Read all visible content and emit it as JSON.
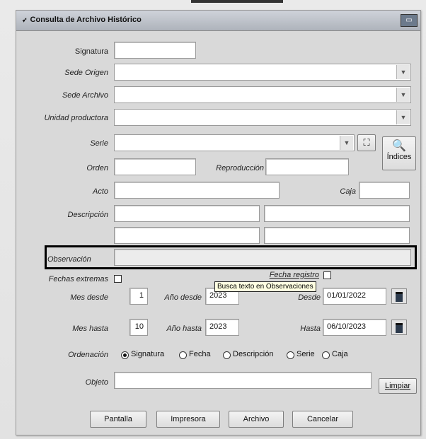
{
  "window": {
    "title": "Consulta de Archivo Histórico",
    "close_glyph": "▭"
  },
  "labels": {
    "signatura": "Signatura",
    "sede_origen": "Sede Origen",
    "sede_archivo": "Sede Archivo",
    "unidad_productora": "Unidad productora",
    "serie": "Serie",
    "orden": "Orden",
    "reproduccion": "Reproducción",
    "acto": "Acto",
    "caja": "Caja",
    "descripcion": "Descripción",
    "observacion": "Observación",
    "fechas_extremas": "Fechas extremas",
    "fecha_registro": "Fecha registro",
    "mes_desde": "Mes desde",
    "anio_desde": "Año desde",
    "desde": "Desde",
    "mes_hasta": "Mes hasta",
    "anio_hasta": "Año hasta",
    "hasta": "Hasta",
    "ordenacion": "Ordenación",
    "objeto": "Objeto"
  },
  "fields": {
    "mes_desde": "1",
    "anio_desde": "2023",
    "desde": "01/01/2022",
    "mes_hasta": "10",
    "anio_hasta": "2023",
    "hasta": "06/10/2023"
  },
  "tooltip": "Busca texto en Observaciones",
  "ordenacion_options": [
    {
      "label": "Signatura",
      "selected": true
    },
    {
      "label": "Fecha",
      "selected": false
    },
    {
      "label": "Descripción",
      "selected": false
    },
    {
      "label": "Serie",
      "selected": false
    },
    {
      "label": "Caja",
      "selected": false
    }
  ],
  "buttons": {
    "indices": "Índices",
    "limpiar": "Limpiar",
    "pantalla": "Pantalla",
    "impresora": "Impresora",
    "archivo": "Archivo",
    "cancelar": "Cancelar"
  },
  "icons": {
    "binoculars": "binoculars-icon",
    "indices": "search-doc-icon",
    "calendar": "calendar-icon",
    "dropdown": "chevron-down-icon"
  }
}
